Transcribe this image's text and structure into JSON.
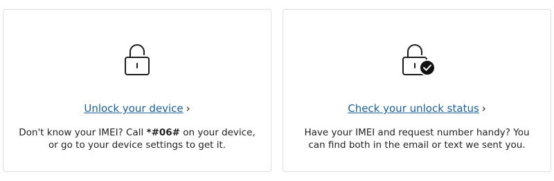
{
  "cards": [
    {
      "icon": "unlocked-padlock-icon",
      "link_label": "Unlock your device",
      "link_chevron": "›",
      "description_prefix": "Don't know your IMEI? Call ",
      "description_code": "*#06#",
      "description_suffix": " on your device, or go to your device settings to get it."
    },
    {
      "icon": "unlocked-padlock-check-icon",
      "link_label": "Check your unlock status",
      "link_chevron": "›",
      "description": "Have your IMEI and request number handy? You can find both in the email or text we sent you."
    }
  ],
  "colors": {
    "link": "#1a5fa0",
    "border": "#dcdcdc",
    "text": "#1f1f1f"
  }
}
